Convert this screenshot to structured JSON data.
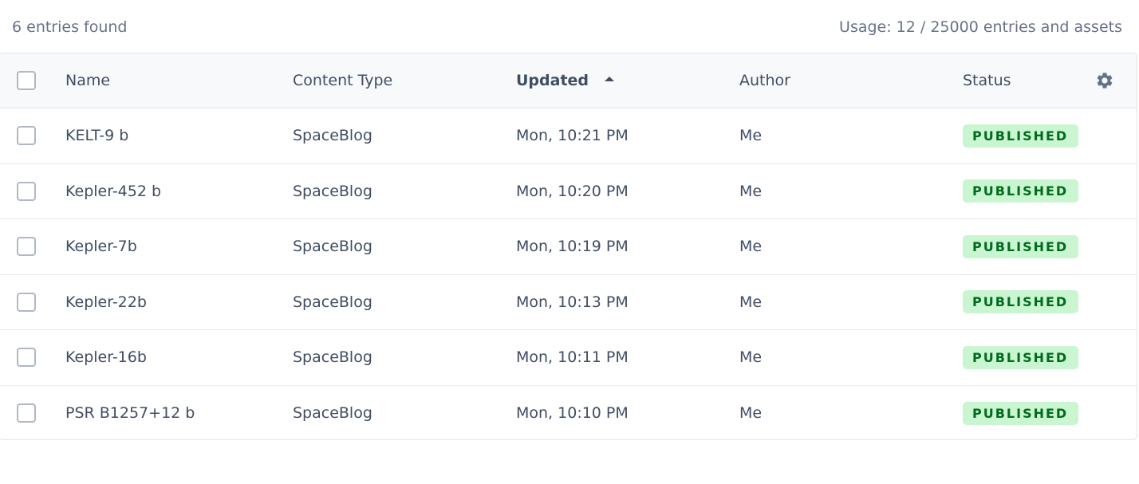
{
  "summary": {
    "entries_found": "6 entries found",
    "usage": "Usage: 12 / 25000 entries and assets"
  },
  "table": {
    "headers": {
      "name": "Name",
      "content_type": "Content Type",
      "updated": "Updated",
      "author": "Author",
      "status": "Status"
    },
    "sort_column": "updated",
    "sort_direction": "asc",
    "rows": [
      {
        "name": "KELT-9 b",
        "content_type": "SpaceBlog",
        "updated": "Mon, 10:21 PM",
        "author": "Me",
        "status": "PUBLISHED"
      },
      {
        "name": "Kepler-452 b",
        "content_type": "SpaceBlog",
        "updated": "Mon, 10:20 PM",
        "author": "Me",
        "status": "PUBLISHED"
      },
      {
        "name": "Kepler-7b",
        "content_type": "SpaceBlog",
        "updated": "Mon, 10:19 PM",
        "author": "Me",
        "status": "PUBLISHED"
      },
      {
        "name": "Kepler-22b",
        "content_type": "SpaceBlog",
        "updated": "Mon, 10:13 PM",
        "author": "Me",
        "status": "PUBLISHED"
      },
      {
        "name": "Kepler-16b",
        "content_type": "SpaceBlog",
        "updated": "Mon, 10:11 PM",
        "author": "Me",
        "status": "PUBLISHED"
      },
      {
        "name": "PSR B1257+12 b",
        "content_type": "SpaceBlog",
        "updated": "Mon, 10:10 PM",
        "author": "Me",
        "status": "PUBLISHED"
      }
    ]
  },
  "icons": {
    "settings": "gear-icon",
    "sort": "sort-up-icon"
  },
  "colors": {
    "published_bg": "#c9f5d0",
    "published_text": "#006a1d",
    "header_bg": "#f7f9fa"
  }
}
